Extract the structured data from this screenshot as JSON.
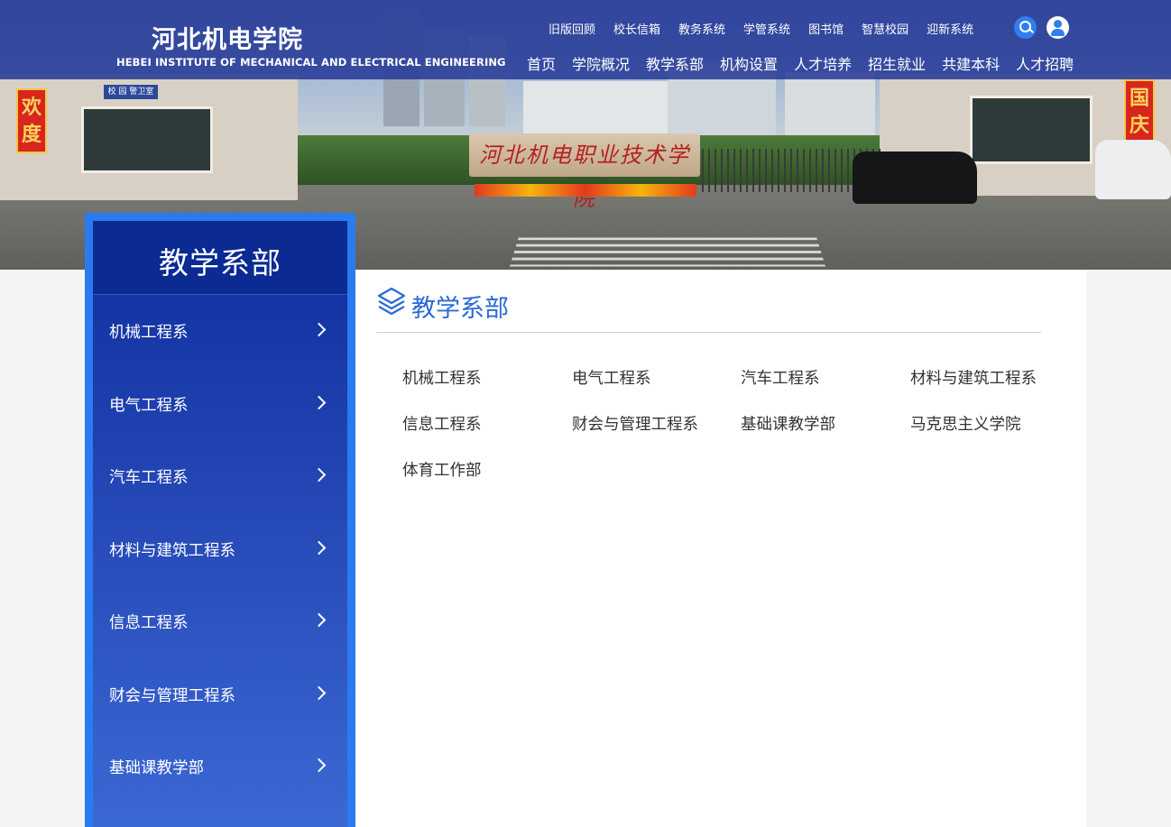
{
  "header": {
    "logo_cn": "河北机电学院",
    "logo_en": "HEBEI INSTITUTE OF MECHANICAL AND ELECTRICAL ENGINEERING",
    "top_links": [
      "旧版回顾",
      "校长信箱",
      "教务系统",
      "学管系统",
      "图书馆",
      "智慧校园",
      "迎新系统"
    ],
    "main_nav": [
      "首页",
      "学院概况",
      "教学系部",
      "机构设置",
      "人才培养",
      "招生就业",
      "共建本科",
      "人才招聘"
    ],
    "search_icon": "search-icon",
    "user_icon": "user-icon"
  },
  "banner": {
    "sign_left": "欢度",
    "sign_right": "国庆",
    "stone_text": "河北机电职业技术学院",
    "guard_sign": "校 园 警卫室"
  },
  "sidebar": {
    "title": "教学系部",
    "items": [
      "机械工程系",
      "电气工程系",
      "汽车工程系",
      "材料与建筑工程系",
      "信息工程系",
      "财会与管理工程系",
      "基础课教学部"
    ]
  },
  "main": {
    "section_title": "教学系部",
    "departments": [
      "机械工程系",
      "电气工程系",
      "汽车工程系",
      "材料与建筑工程系",
      "信息工程系",
      "财会与管理工程系",
      "基础课教学部",
      "马克思主义学院",
      "体育工作部"
    ]
  },
  "colors": {
    "header_bg": "#233796",
    "sidebar_accent": "#2a7bf0",
    "title_blue": "#2a6ad6"
  }
}
